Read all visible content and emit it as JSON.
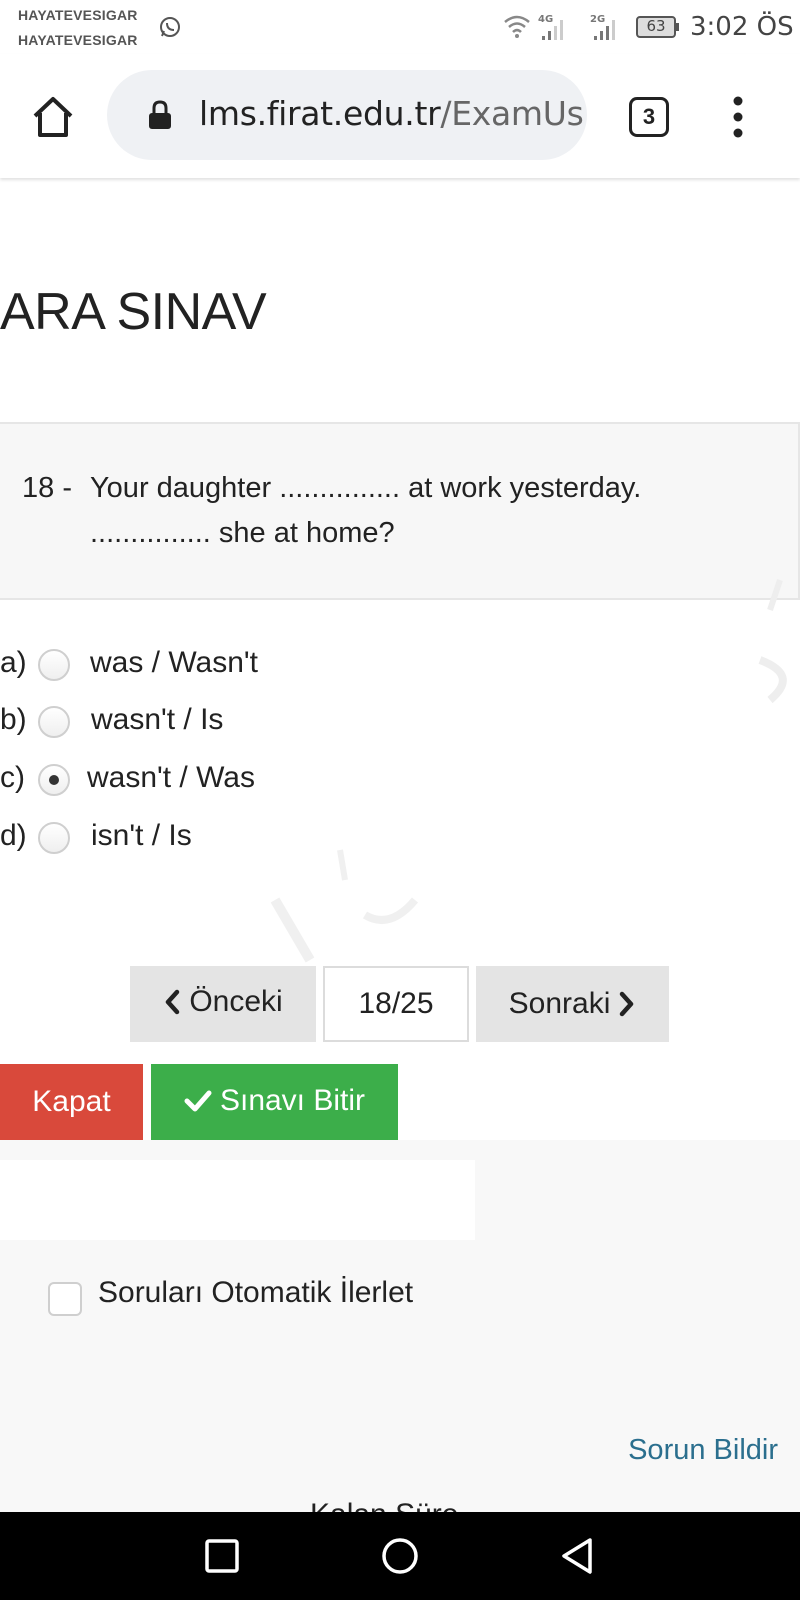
{
  "status_bar": {
    "carrier_1": "HAYATEVESIGAR",
    "carrier_2": "HAYATEVESIGAR",
    "network_1": "4G",
    "network_2": "2G",
    "battery": "63",
    "time": "3:02 ÖS"
  },
  "browser": {
    "url_host": "lms.firat.edu.tr",
    "url_path": "/ExamUs",
    "tab_count": "3"
  },
  "page": {
    "title": "ARA SINAV"
  },
  "question": {
    "number": "18 -",
    "line1": "Your daughter ............... at work yesterday.",
    "line2": "............... she at home?"
  },
  "options": [
    {
      "letter": "a)",
      "text": "was / Wasn't",
      "selected": false
    },
    {
      "letter": "b)",
      "text": "wasn't / Is",
      "selected": false
    },
    {
      "letter": "c)",
      "text": "wasn't / Was",
      "selected": true
    },
    {
      "letter": "d)",
      "text": "isn't / Is",
      "selected": false
    }
  ],
  "pager": {
    "prev_label": "Önceki",
    "indicator": "18/25",
    "next_label": "Sonraki"
  },
  "actions": {
    "close_label": "Kapat",
    "finish_label": "Sınavı Bitir"
  },
  "settings": {
    "auto_advance_label": "Soruları Otomatik İlerlet",
    "auto_advance_checked": false
  },
  "footer": {
    "report_label": "Sorun Bildir",
    "cut_text": "Kalan Süre"
  },
  "colors": {
    "close_button": "#d9493b",
    "finish_button": "#3cae4a",
    "link": "#2b6f8e"
  }
}
